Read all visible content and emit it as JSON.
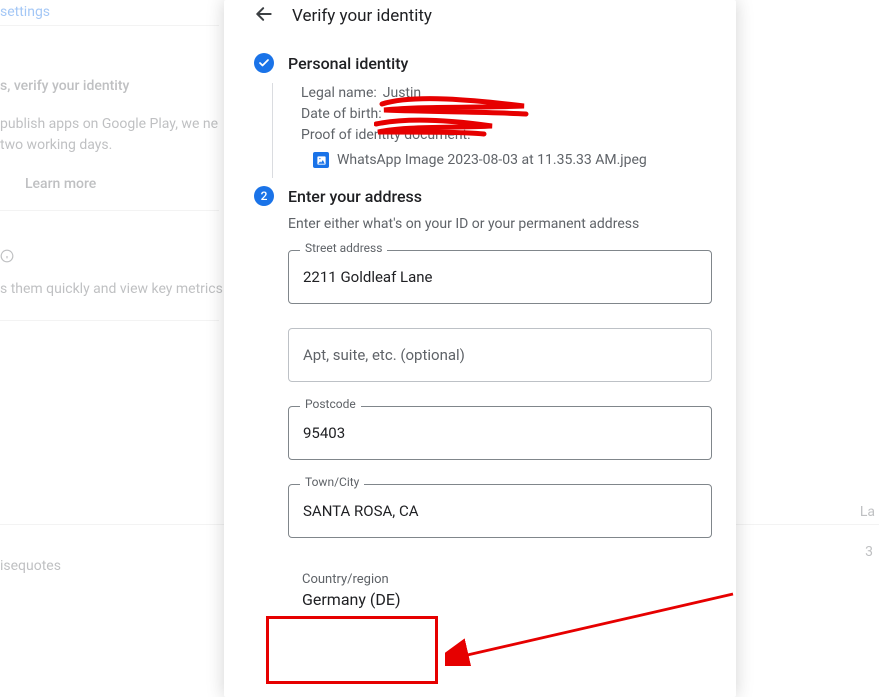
{
  "background": {
    "settings": "settings",
    "verify": "s, verify your identity",
    "publish_line1": "publish apps on Google Play, we ne",
    "publish_line2": "two working days.",
    "learn_more": "Learn more",
    "metrics": "s them quickly and view key metrics",
    "la": "La",
    "three": "3",
    "isequotes": "isequotes"
  },
  "dialog": {
    "title": "Verify your identity"
  },
  "personal": {
    "title": "Personal identity",
    "legal_name_label": "Legal name:",
    "legal_name_value": "Justin",
    "dob_label": "Date of birth:",
    "dob_value": "",
    "proof_label": "Proof of identity document:",
    "file_name": "WhatsApp Image 2023-08-03 at 11.35.33 AM.jpeg"
  },
  "address": {
    "step": "2",
    "title": "Enter your address",
    "subtitle": "Enter either what's on your ID or your permanent address",
    "street_label": "Street address",
    "street_value": "2211 Goldleaf Lane",
    "apt_placeholder": "Apt, suite, etc. (optional)",
    "postcode_label": "Postcode",
    "postcode_value": "95403",
    "city_label": "Town/City",
    "city_value": "SANTA ROSA, CA",
    "country_label": "Country/region",
    "country_value": "Germany (DE)"
  }
}
